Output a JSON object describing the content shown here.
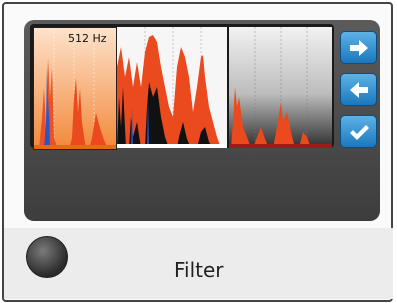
{
  "display": {
    "frequency_label": "512 Hz"
  },
  "colors": {
    "panel1_bg": "#f7a15a",
    "spectrum_red": "#ea4a1e",
    "spectrum_blue": "#2a55c8",
    "accent_blue": "#1b77bc"
  },
  "nav": {
    "next_icon": "arrow-right-icon",
    "back_icon": "arrow-left-icon",
    "confirm_icon": "checkmark-icon"
  },
  "footer": {
    "label": "Filter"
  }
}
